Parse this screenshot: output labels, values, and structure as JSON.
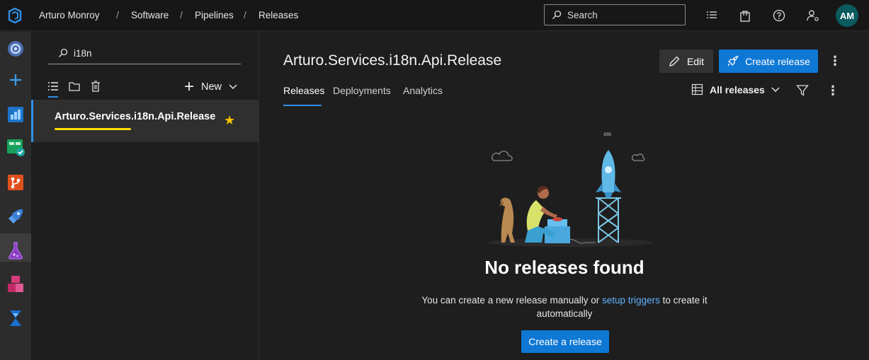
{
  "breadcrumb": {
    "items": [
      "Arturo Monroy",
      "Software",
      "Pipelines",
      "Releases"
    ],
    "separator": "/"
  },
  "topbar": {
    "search_placeholder": "Search",
    "avatar_initials": "AM"
  },
  "sidebar": {
    "filter_value": "i18n",
    "new_label": "New",
    "definitions": [
      {
        "name": "Arturo.Services.i18n.Api.Release",
        "favorite": true
      }
    ]
  },
  "main": {
    "title": "Arturo.Services.i18n.Api.Release",
    "edit_label": "Edit",
    "create_release_label": "Create release",
    "tabs": [
      {
        "label": "Releases",
        "active": true
      },
      {
        "label": "Deployments",
        "active": false
      },
      {
        "label": "Analytics",
        "active": false
      }
    ],
    "view_selector": "All releases",
    "empty_state": {
      "title": "No releases found",
      "desc_before": "You can create a new release manually or ",
      "desc_link": "setup triggers",
      "desc_after": " to create it automatically",
      "button_label": "Create a release"
    }
  },
  "colors": {
    "accent": "#0f78d4",
    "link": "#5fb2ff",
    "star": "#f8c300",
    "highlight_underline": "#ffe000",
    "avatar_bg": "#0a5a5e"
  }
}
